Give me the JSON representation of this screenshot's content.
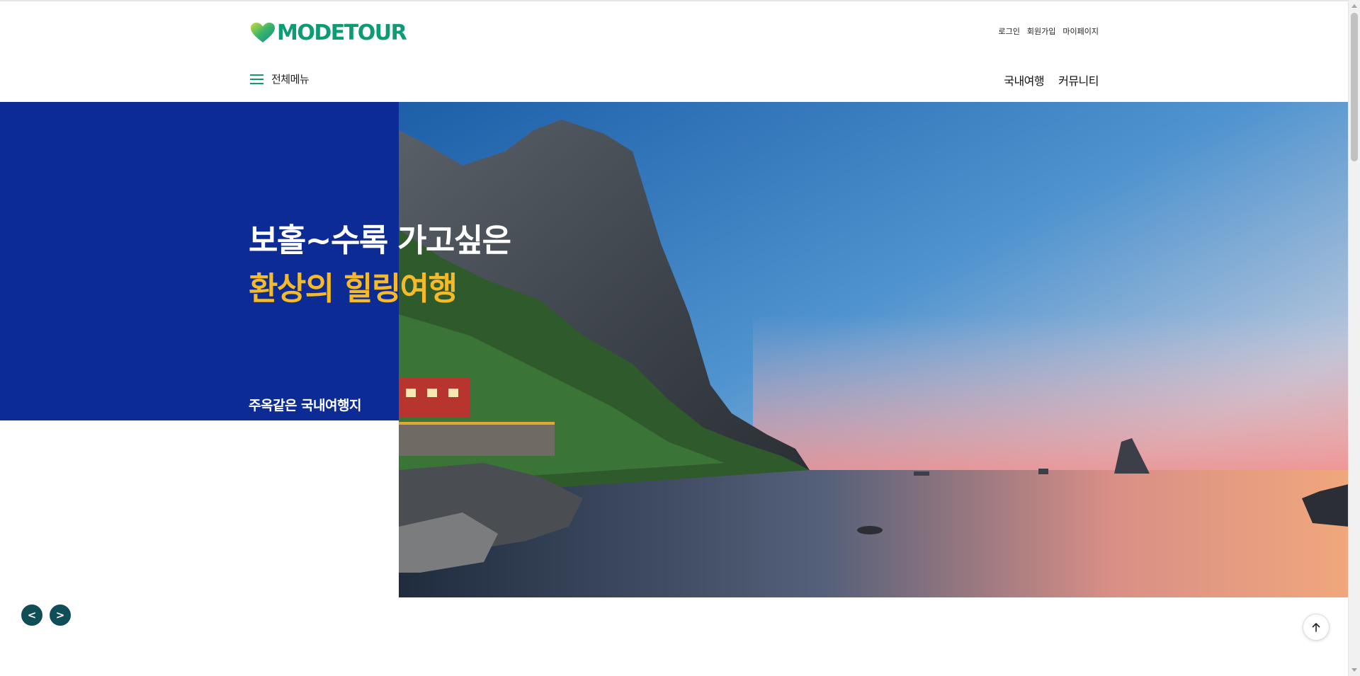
{
  "header": {
    "logo_text": "MODETOUR",
    "util_nav": [
      "로그인",
      "회원가입",
      "마이페이지"
    ],
    "menu_label": "전체메뉴",
    "gnb": [
      "국내여행",
      "커뮤니티"
    ]
  },
  "hero": {
    "title_line1": "보홀~수록 가고싶은",
    "title_line2": "환상의 힐링여행",
    "subtitle": "주옥같은 국내여행지",
    "prev_label": "<",
    "next_label": ">"
  },
  "icons": {
    "logo": "heart-logo-icon",
    "menu": "hamburger-icon",
    "to_top": "arrow-up-icon"
  },
  "colors": {
    "brand_green": "#0c9b72",
    "panel_blue": "#0d2b95",
    "highlight_yellow": "#f5ba2a",
    "slider_button": "#0f4d57"
  }
}
